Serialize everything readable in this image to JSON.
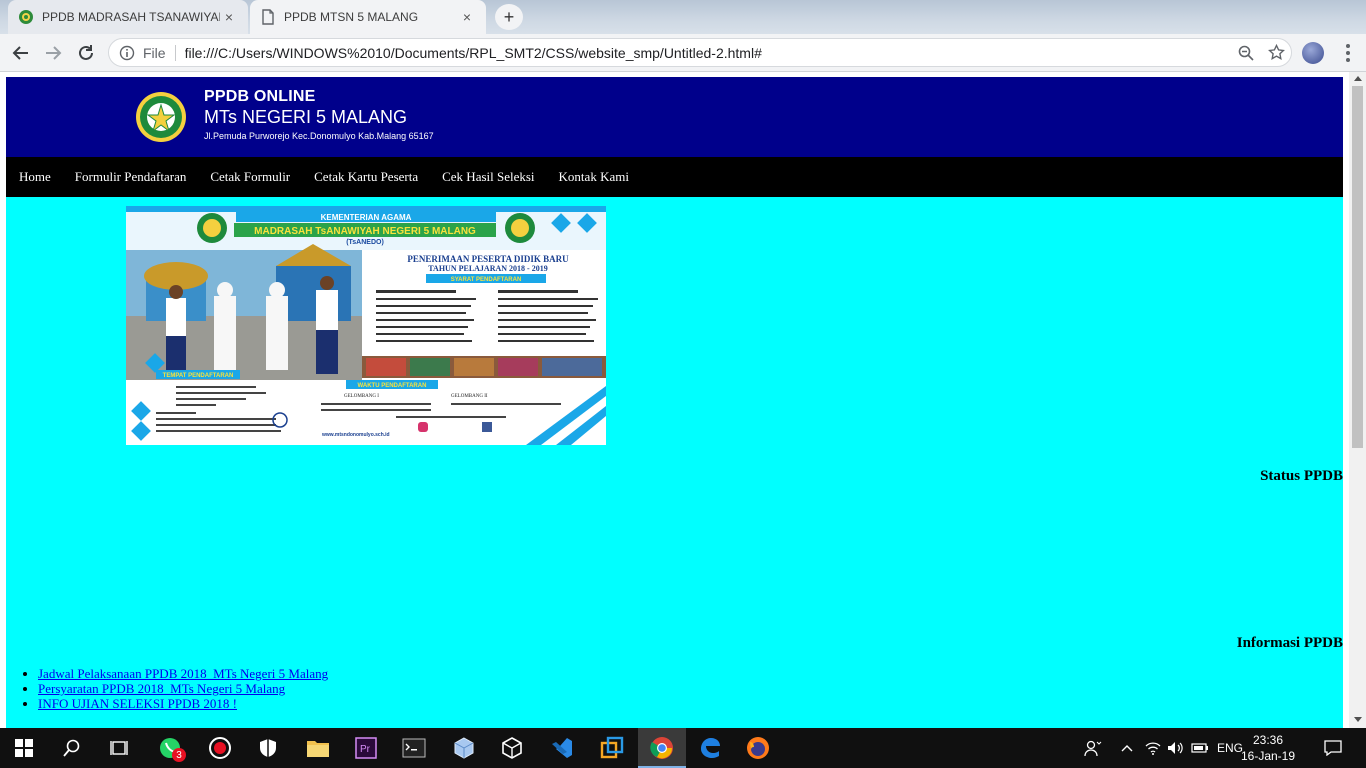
{
  "browser": {
    "tabs": [
      {
        "title": "PPDB MADRASAH TSANAWIYAH",
        "close": "×"
      },
      {
        "title": "PPDB MTSN 5 MALANG",
        "close": "×"
      }
    ],
    "new_tab": "+",
    "file_label": "File",
    "url": "file:///C:/Users/WINDOWS%2010/Documents/RPL_SMT2/CSS/website_smp/Untitled-2.html#"
  },
  "site": {
    "header": {
      "line1": "PPDB ONLINE",
      "line2": "MTs NEGERI 5 MALANG",
      "address": "Jl.Pemuda Purworejo Kec.Donomulyo Kab.Malang 65167"
    },
    "nav": [
      "Home",
      "Formulir Pendaftaran",
      "Cetak Formulir",
      "Cetak Kartu Peserta",
      "Cek Hasil Seleksi",
      "Kontak Kami"
    ],
    "banner": {
      "ministry": "KEMENTERIAN AGAMA",
      "school": "MADRASAH TsANAWIYAH NEGERI 5 MALANG",
      "abbr": "(TsANEDO)",
      "heading1": "PENERIMAAN PESERTA DIDIK BARU",
      "heading2": "TAHUN PELAJARAN 2018 - 2019",
      "syarat": "SYARAT PENDAFTARAN",
      "tempat": "TEMPAT PENDAFTARAN",
      "waktu": "WAKTU PENDAFTARAN",
      "gelombang1": "GELOMBANG I",
      "gelombang2": "GELOMBANG II",
      "website": "www.mtsndonomulyo.sch.id"
    },
    "status_title": "Status PPDB",
    "info_title": "Informasi PPDB",
    "info_links": [
      "Jadwal Pelaksanaan PPDB 2018_MTs Negeri 5 Malang",
      "Persyaratan PPDB 2018_MTs Negeri 5 Malang",
      "INFO UJIAN SELEKSI PPDB 2018 !"
    ]
  },
  "taskbar": {
    "whatsapp_badge": "3",
    "language": "ENG",
    "time": "23:36",
    "date": "16-Jan-19"
  },
  "colors": {
    "header_bg": "#00008b",
    "page_bg": "#00ffff",
    "nav_bg": "#000000",
    "link": "#0000ee"
  }
}
